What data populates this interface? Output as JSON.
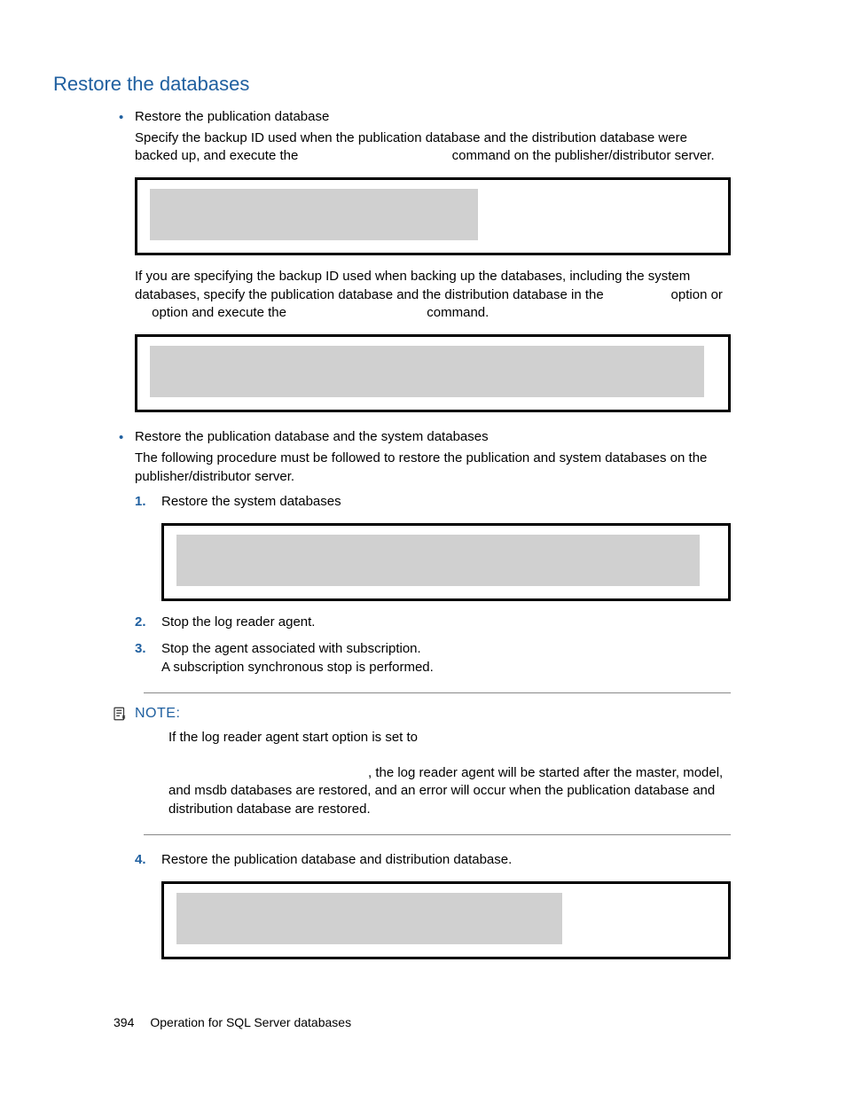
{
  "heading": "Restore the databases",
  "bullet1": {
    "title": "Restore the publication database",
    "para_before": "Specify the backup ID used when the publication database and the distribution database were backed up, and execute the ",
    "para_cmd_gap": "                                           ",
    "para_after": " command on the publisher/distributor server.",
    "mid_before": "If you are specifying the backup ID used when backing up the databases, including the system databases, specify the publication database and the distribution database in the ",
    "mid_after1": " option or ",
    "mid_after2": " option and execute the ",
    "mid_after3": " command."
  },
  "bullet2": {
    "title": "Restore the publication database and the system databases",
    "para": "The following procedure must be followed to restore the publication and system databases on the publisher/distributor server.",
    "steps": {
      "s1": "Restore the system databases",
      "s2": "Stop the log reader agent.",
      "s3": "Stop the agent associated with subscription.",
      "s3b": "A subscription synchronous stop is performed.",
      "s4": "Restore the publication database and distribution database."
    }
  },
  "note": {
    "label": "NOTE:",
    "line1": "If the log reader agent start option is set to ",
    "line2": ", the log reader agent will be started after the master, model, and msdb databases are restored, and an error will occur when the publication database and distribution database are restored."
  },
  "footer": {
    "page": "394",
    "title": "Operation for SQL Server databases"
  }
}
